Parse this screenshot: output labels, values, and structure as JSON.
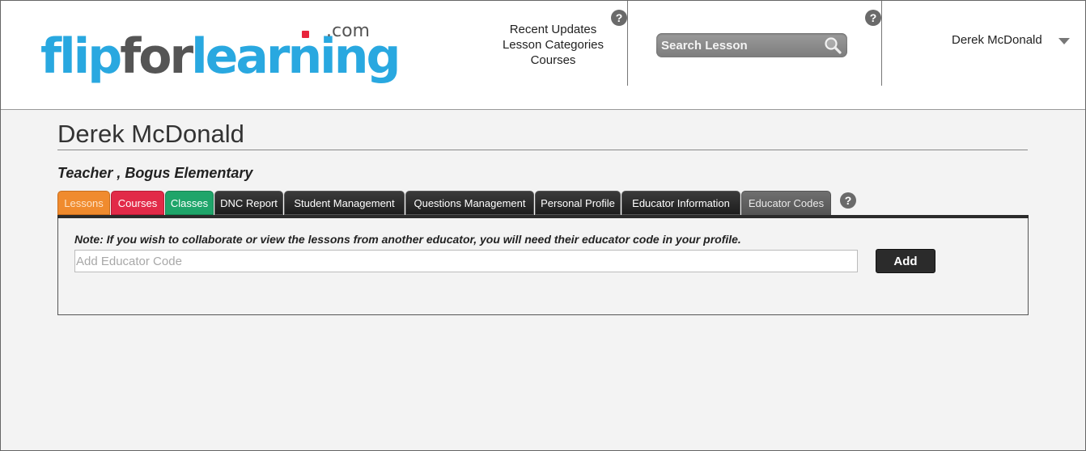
{
  "logo": {
    "text_part1": "flip",
    "text_part2": "for",
    "text_part3": "learning",
    "suffix": ".com",
    "colors": {
      "blue": "#29a8e0",
      "gray": "#555555",
      "red_dot": "#e8243c"
    }
  },
  "header": {
    "nav_links": [
      "Recent Updates",
      "Lesson Categories",
      "Courses"
    ],
    "search_placeholder": "Search Lesson",
    "user_name": "Derek McDonald",
    "help_glyph": "?"
  },
  "profile": {
    "name": "Derek McDonald",
    "role_line": "Teacher , Bogus Elementary"
  },
  "tabs": [
    {
      "label": "Lessons",
      "color": "#f08b2e",
      "text_color": "#fde3c7"
    },
    {
      "label": "Courses",
      "color": "#e22a48",
      "text_color": "#ffffff"
    },
    {
      "label": "Classes",
      "color": "#1fa56a",
      "text_color": "#ffffff"
    },
    {
      "label": "DNC Report",
      "color": "#222222"
    },
    {
      "label": "Student Management",
      "color": "#222222"
    },
    {
      "label": "Questions Management",
      "color": "#222222"
    },
    {
      "label": "Personal Profile",
      "color": "#222222"
    },
    {
      "label": "Educator Information",
      "color": "#222222"
    },
    {
      "label": "Educator Codes",
      "color": "#5f5f5f",
      "active": true
    }
  ],
  "educator_codes": {
    "note": "Note: If you wish to collaborate or view the lessons from another educator, you will need their educator code in your profile.",
    "input_placeholder": "Add Educator Code",
    "add_button": "Add"
  }
}
